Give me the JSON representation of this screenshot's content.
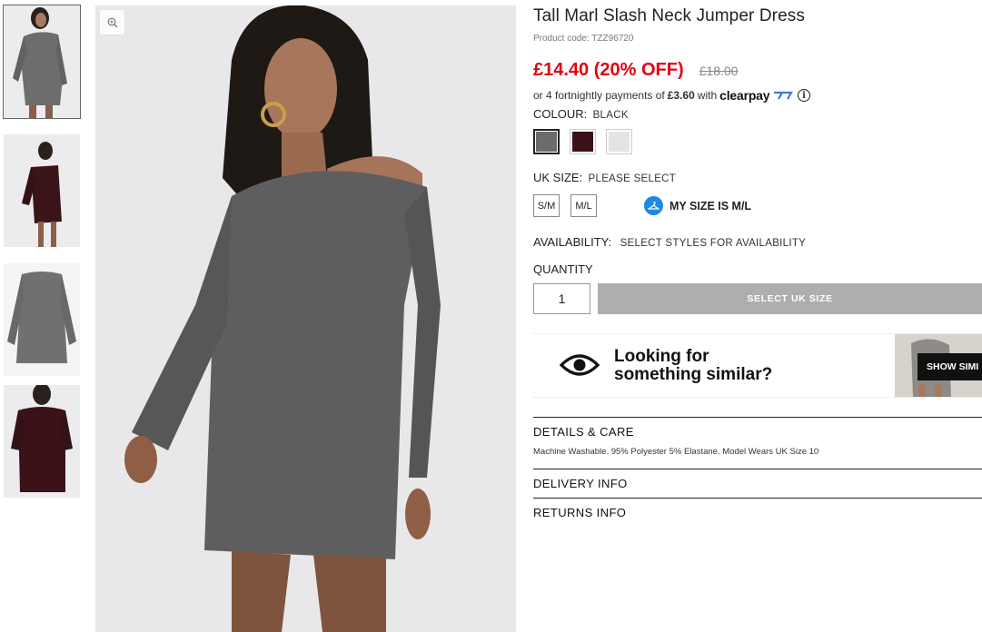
{
  "product": {
    "title": "Tall Marl Slash Neck Jumper Dress",
    "code_label": "Product code: TZZ96720",
    "price_now": "£14.40 (20% OFF)",
    "price_was": "£18.00",
    "clearpay_prefix": "or 4 fortnightly payments of",
    "clearpay_amount": "£3.60",
    "clearpay_with": "with",
    "clearpay_brand": "clearpay",
    "info_icon": "i"
  },
  "colour": {
    "label": "COLOUR:",
    "value": "BLACK",
    "swatches": [
      {
        "name": "charcoal marl",
        "color": "#6b6b6b"
      },
      {
        "name": "wine",
        "color": "#3a1118"
      },
      {
        "name": "light grey",
        "color": "#e4e4e6"
      }
    ]
  },
  "size": {
    "label": "UK SIZE:",
    "value": "PLEASE SELECT",
    "options": [
      "S/M",
      "M/L"
    ],
    "my_size": "MY SIZE IS M/L",
    "my_size_icon": "hanger-icon"
  },
  "availability": {
    "label": "AVAILABILITY:",
    "value": "SELECT STYLES FOR AVAILABILITY"
  },
  "quantity": {
    "label": "QUANTITY",
    "value": "1"
  },
  "cta": {
    "label": "SELECT UK SIZE"
  },
  "similar": {
    "line1": "Looking for",
    "line2": "something similar?",
    "button": "SHOW SIMI",
    "icon": "eye-icon"
  },
  "details": {
    "heading": "DETAILS & CARE",
    "text": "Machine Washable. 95% Polyester 5% Elastane. Model Wears UK Size 10"
  },
  "delivery": {
    "heading": "DELIVERY INFO"
  },
  "returns": {
    "heading": "RETURNS INFO"
  },
  "colors": {
    "sale_red": "#e3000f",
    "cta_grey": "#aeaeae",
    "mysize_blue": "#1e88e5"
  }
}
